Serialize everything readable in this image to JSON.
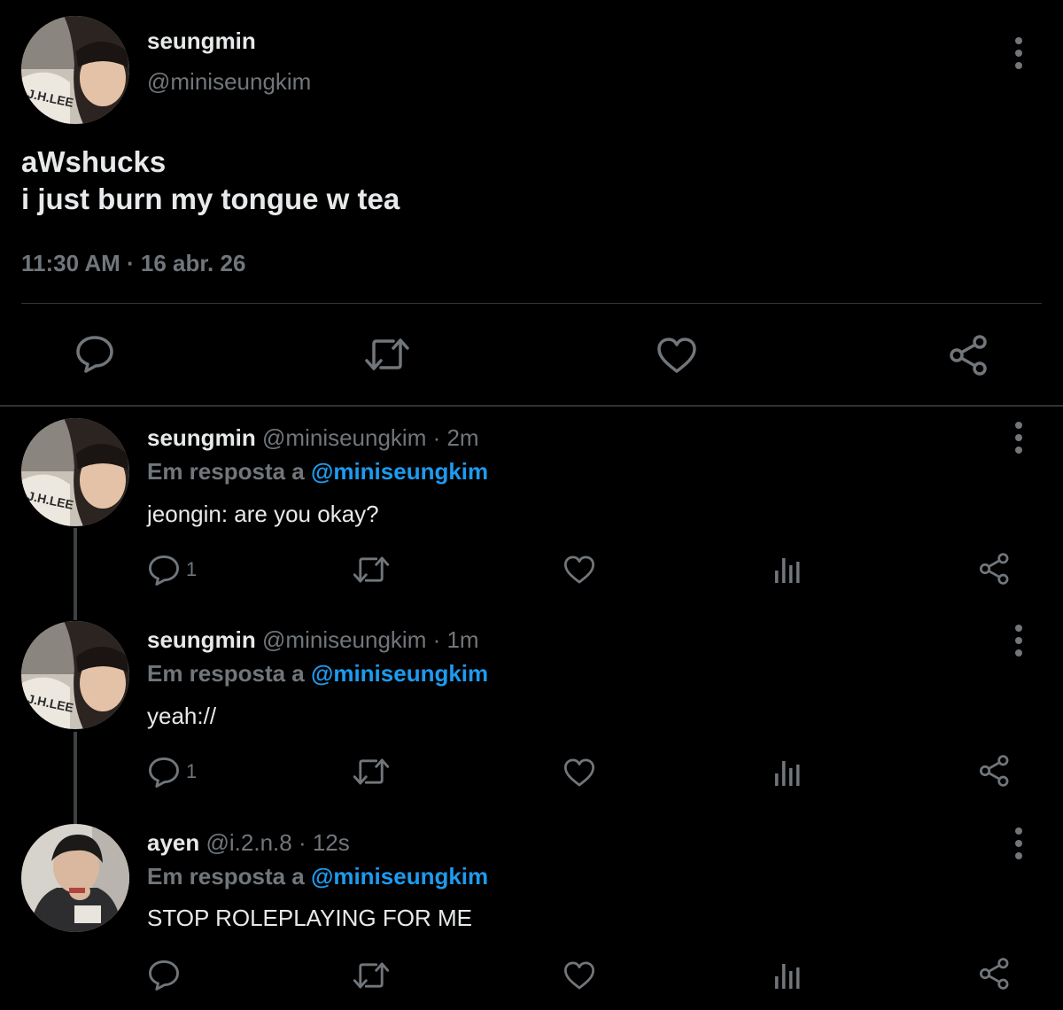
{
  "main_tweet": {
    "author_name": "seungmin",
    "author_handle": "@miniseungkim",
    "text_line1": "aWshucks",
    "text_line2": "i just burn my tongue w tea",
    "timestamp": "11:30 AM · 16 abr. 26",
    "actions": [
      "reply-icon",
      "retweet-icon",
      "like-icon",
      "share-icon"
    ]
  },
  "replies": [
    {
      "name": "seungmin",
      "handle_time": "@miniseungkim · 2m",
      "replying_prefix": "Em resposta a ",
      "replying_to": "@miniseungkim",
      "text": "jeongin: are you okay?",
      "reply_count": "1"
    },
    {
      "name": "seungmin",
      "handle_time": "@miniseungkim · 1m",
      "replying_prefix": "Em resposta a ",
      "replying_to": "@miniseungkim",
      "text": "yeah://",
      "reply_count": "1"
    },
    {
      "name": "ayen",
      "handle_time": "@i.2.n.8 · 12s",
      "replying_prefix": "Em resposta a ",
      "replying_to": "@miniseungkim",
      "text": "STOP ROLEPLAYING FOR ME",
      "reply_count": ""
    }
  ],
  "colors": {
    "background": "#000000",
    "text_primary": "#e7e9ea",
    "text_secondary": "#71767b",
    "mention_blue": "#1d9bf0",
    "divider": "#2f3336"
  }
}
